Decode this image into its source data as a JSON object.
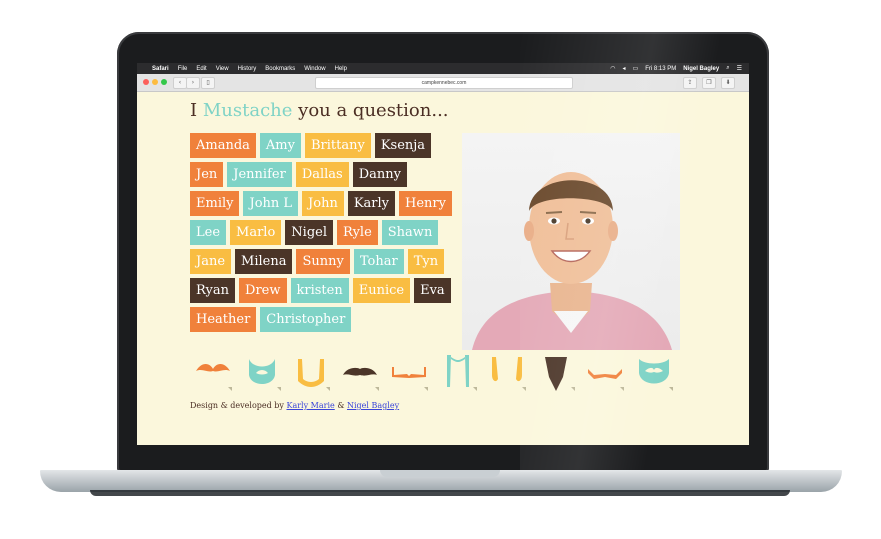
{
  "menubar": {
    "apple": "",
    "app": "Safari",
    "items": [
      "File",
      "Edit",
      "View",
      "History",
      "Bookmarks",
      "Window",
      "Help"
    ],
    "clock": "Fri 8:13 PM",
    "user": "Nigel Bagley"
  },
  "browser": {
    "url": "campkennebec.com"
  },
  "page": {
    "title_prefix": "I",
    "title_accent": "Mustache",
    "title_suffix": "you a question...",
    "names": [
      {
        "label": "Amanda",
        "color": "#f0813b"
      },
      {
        "label": "Amy",
        "color": "#7fd3c6"
      },
      {
        "label": "Brittany",
        "color": "#f9bd42"
      },
      {
        "label": "Ksenja",
        "color": "#4b3528"
      },
      {
        "label": "Jen",
        "color": "#f0813b"
      },
      {
        "label": "Jennifer",
        "color": "#7fd3c6"
      },
      {
        "label": "Dallas",
        "color": "#f9bd42"
      },
      {
        "label": "Danny",
        "color": "#4b3528"
      },
      {
        "label": "Emily",
        "color": "#f0813b"
      },
      {
        "label": "John L",
        "color": "#7fd3c6"
      },
      {
        "label": "John",
        "color": "#f9bd42"
      },
      {
        "label": "Karly",
        "color": "#4b3528"
      },
      {
        "label": "Henry",
        "color": "#f0813b"
      },
      {
        "label": "Lee",
        "color": "#7fd3c6"
      },
      {
        "label": "Marlo",
        "color": "#f9bd42"
      },
      {
        "label": "Nigel",
        "color": "#4b3528"
      },
      {
        "label": "Ryle",
        "color": "#f0813b"
      },
      {
        "label": "Shawn",
        "color": "#7fd3c6"
      },
      {
        "label": "Jane",
        "color": "#f9bd42"
      },
      {
        "label": "Milena",
        "color": "#4b3528"
      },
      {
        "label": "Sunny",
        "color": "#f0813b"
      },
      {
        "label": "Tohar",
        "color": "#7fd3c6"
      },
      {
        "label": "Tyn",
        "color": "#f9bd42"
      },
      {
        "label": "Ryan",
        "color": "#4b3528"
      },
      {
        "label": "Drew",
        "color": "#f0813b"
      },
      {
        "label": "kristen",
        "color": "#7fd3c6"
      },
      {
        "label": "Eunice",
        "color": "#f9bd42"
      },
      {
        "label": "Eva",
        "color": "#4b3528"
      },
      {
        "label": "Heather",
        "color": "#f0813b"
      },
      {
        "label": "Christopher",
        "color": "#7fd3c6"
      }
    ],
    "credit_prefix": "Design & developed by",
    "credit_author1": "Karly Marie",
    "credit_amp": "&",
    "credit_author2": "Nigel Bagley",
    "mustache_icons": [
      {
        "name": "handlebar-mustache-icon",
        "color": "#f0813b"
      },
      {
        "name": "full-beard-icon",
        "color": "#7fd3c6"
      },
      {
        "name": "horseshoe-mustache-icon",
        "color": "#f9bd42"
      },
      {
        "name": "walrus-mustache-icon",
        "color": "#4b3528"
      },
      {
        "name": "pencil-mustache-icon",
        "color": "#f0813b"
      },
      {
        "name": "long-horseshoe-icon",
        "color": "#7fd3c6"
      },
      {
        "name": "fu-manchu-icon",
        "color": "#f9bd42"
      },
      {
        "name": "goatee-icon",
        "color": "#4b3528"
      },
      {
        "name": "thin-curl-mustache-icon",
        "color": "#f0813b"
      },
      {
        "name": "beard-mustache-icon",
        "color": "#7fd3c6"
      }
    ]
  }
}
